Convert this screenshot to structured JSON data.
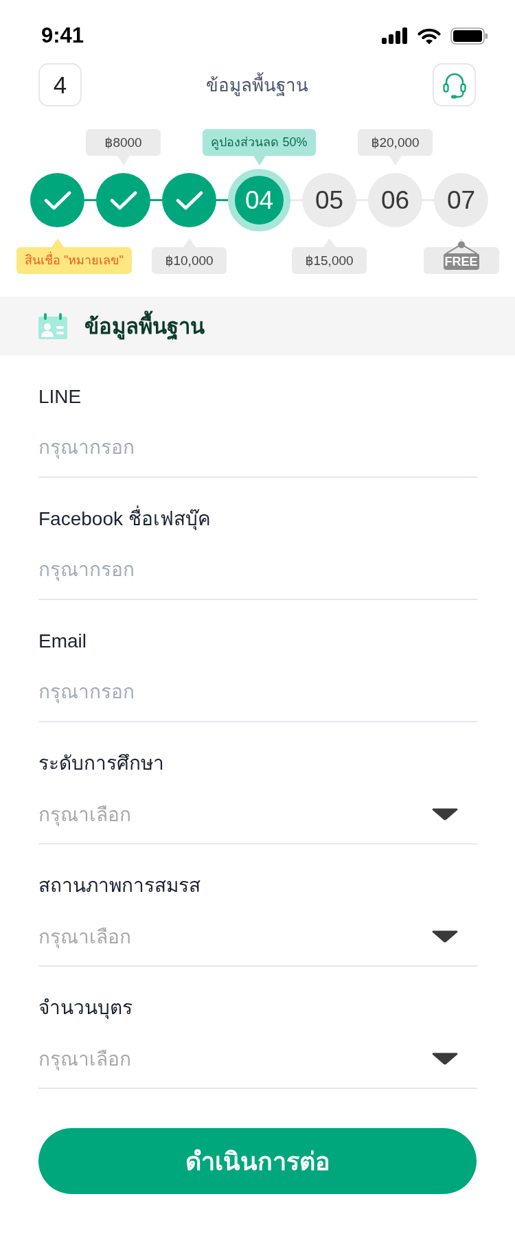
{
  "status_bar": {
    "time": "9:41"
  },
  "header": {
    "badge": "4",
    "title": "ข้อมูลพื้นฐาน"
  },
  "steps": [
    {
      "completed": true,
      "current": false,
      "tag_below": {
        "kind": "loan",
        "text": "สินเชื่อ \"หมายเลข\""
      }
    },
    {
      "completed": true,
      "current": false,
      "tag_above": {
        "kind": "price",
        "text": "฿8000"
      }
    },
    {
      "completed": true,
      "current": false,
      "tag_below": {
        "kind": "price",
        "text": "฿10,000"
      }
    },
    {
      "number": "04",
      "completed": false,
      "current": true,
      "tag_above": {
        "kind": "coupon",
        "text": "คูปองส่วนลด 50%"
      }
    },
    {
      "number": "05",
      "completed": false,
      "current": false,
      "tag_below": {
        "kind": "price",
        "text": "฿15,000"
      }
    },
    {
      "number": "06",
      "completed": false,
      "current": false,
      "tag_above": {
        "kind": "price",
        "text": "฿20,000"
      }
    },
    {
      "number": "07",
      "completed": false,
      "current": false,
      "tag_below": {
        "kind": "free",
        "text": "FREE"
      }
    }
  ],
  "section": {
    "title": "ข้อมูลพื้นฐาน"
  },
  "fields": [
    {
      "kind": "text",
      "label": "LINE",
      "placeholder": "กรุณากรอก"
    },
    {
      "kind": "text",
      "label": "Facebook ชื่อเฟสบุ๊ค",
      "placeholder": "กรุณากรอก"
    },
    {
      "kind": "text",
      "label": "Email",
      "placeholder": "กรุณากรอก"
    },
    {
      "kind": "select",
      "label": "ระดับการศึกษา",
      "placeholder": "กรุณาเลือก"
    },
    {
      "kind": "select",
      "label": "สถานภาพการสมรส",
      "placeholder": "กรุณาเลือก"
    },
    {
      "kind": "select",
      "label": "จำนวนบุตร",
      "placeholder": "กรุณาเลือก"
    }
  ],
  "submit_button": "ดำเนินการต่อ"
}
